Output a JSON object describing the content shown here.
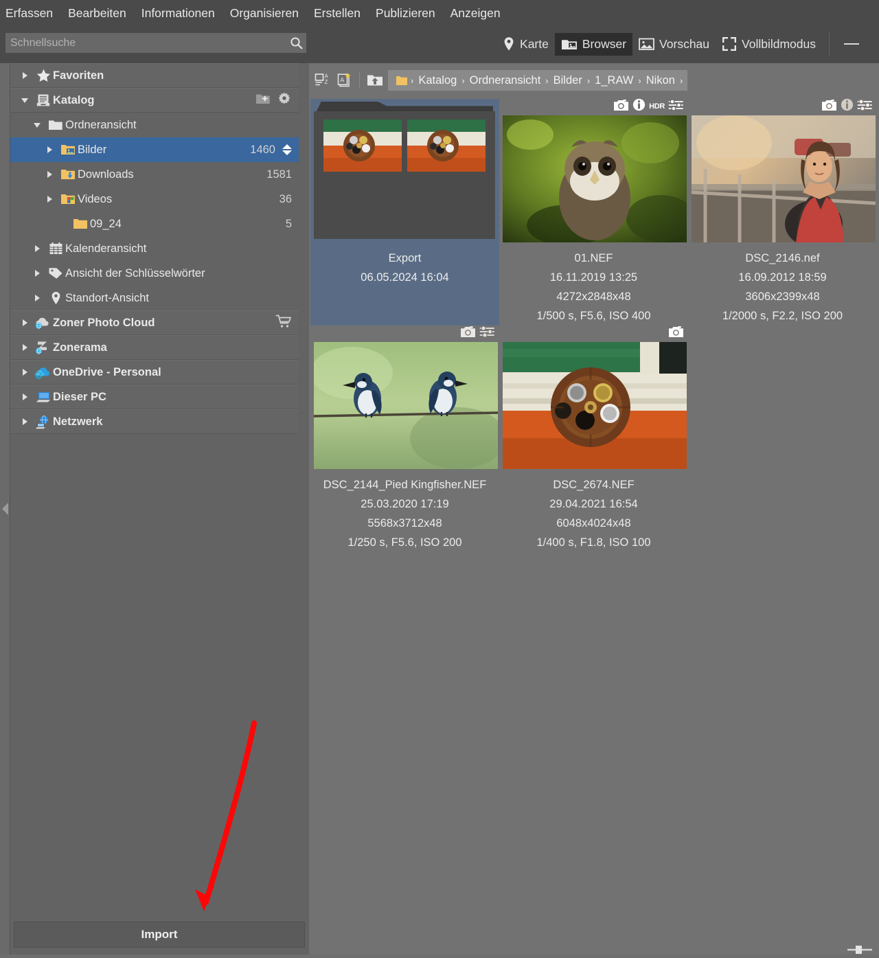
{
  "menu": {
    "items": [
      {
        "label": "Erfassen",
        "name": "menu-erfassen"
      },
      {
        "label": "Bearbeiten",
        "name": "menu-bearbeiten"
      },
      {
        "label": "Informationen",
        "name": "menu-informationen"
      },
      {
        "label": "Organisieren",
        "name": "menu-organisieren"
      },
      {
        "label": "Erstellen",
        "name": "menu-erstellen"
      },
      {
        "label": "Publizieren",
        "name": "menu-publizieren"
      },
      {
        "label": "Anzeigen",
        "name": "menu-anzeigen"
      }
    ]
  },
  "search": {
    "value": "",
    "placeholder": "Schnellsuche",
    "icon": "search-icon"
  },
  "viewmodes": {
    "items": [
      {
        "label": "Karte",
        "icon": "map-pin-icon",
        "active": false
      },
      {
        "label": "Browser",
        "icon": "browser-folder-icon",
        "active": true
      },
      {
        "label": "Vorschau",
        "icon": "preview-image-icon",
        "active": false
      },
      {
        "label": "Vollbildmodus",
        "icon": "fullscreen-icon",
        "active": false
      }
    ]
  },
  "window": {
    "minimize_label": "Minimieren"
  },
  "sidebar": {
    "nodes": [
      {
        "label": "Favoriten",
        "count": "",
        "icon": "star-icon",
        "level": 1,
        "twisty": "right",
        "bold": true,
        "group": true
      },
      {
        "label": "Katalog",
        "count": "",
        "icon": "catalog-icon",
        "level": 1,
        "twisty": "down",
        "bold": true,
        "group": true,
        "actions": [
          "add-folder-icon",
          "gear-icon"
        ]
      },
      {
        "label": "Ordneransicht",
        "count": "",
        "icon": "folder-icon",
        "level": 2,
        "twisty": "down",
        "bold": false
      },
      {
        "label": "Bilder",
        "count": "1460",
        "icon": "folder-pictures-icon",
        "level": 3,
        "twisty": "right",
        "bold": false,
        "selected": true,
        "sorter": true
      },
      {
        "label": "Downloads",
        "count": "1581",
        "icon": "folder-downloads-icon",
        "level": 3,
        "twisty": "right",
        "bold": false
      },
      {
        "label": "Videos",
        "count": "36",
        "icon": "folder-videos-icon",
        "level": 3,
        "twisty": "right",
        "bold": false
      },
      {
        "label": "09_24",
        "count": "5",
        "icon": "folder-icon",
        "level": 4,
        "twisty": "none",
        "bold": false
      },
      {
        "label": "Kalenderansicht",
        "count": "",
        "icon": "calendar-icon",
        "level": 2,
        "twisty": "right",
        "bold": false
      },
      {
        "label": "Ansicht der Schlüsselwörter",
        "count": "",
        "icon": "tag-icon",
        "level": 2,
        "twisty": "right",
        "bold": false
      },
      {
        "label": "Standort-Ansicht",
        "count": "",
        "icon": "map-pin-icon",
        "level": 2,
        "twisty": "right",
        "bold": false
      },
      {
        "label": "Zoner Photo Cloud",
        "count": "",
        "icon": "cloud-globe-icon",
        "level": 1,
        "twisty": "right",
        "bold": true,
        "group": true,
        "actions": [
          "cart-icon"
        ]
      },
      {
        "label": "Zonerama",
        "count": "",
        "icon": "zonerama-icon",
        "level": 1,
        "twisty": "right",
        "bold": true,
        "group": true
      },
      {
        "label": "OneDrive - Personal",
        "count": "",
        "icon": "onedrive-icon",
        "level": 1,
        "twisty": "right",
        "bold": true,
        "group": true
      },
      {
        "label": "Dieser PC",
        "count": "",
        "icon": "computer-icon",
        "level": 1,
        "twisty": "right",
        "bold": true,
        "group": true
      },
      {
        "label": "Netzwerk",
        "count": "",
        "icon": "network-icon",
        "level": 1,
        "twisty": "right",
        "bold": true,
        "group": true
      }
    ],
    "import_label": "Import",
    "collapse_handle": "collapse-sidebar-handle"
  },
  "breadcrumb": {
    "toolbuttons": [
      "sort-az-icon",
      "filter-copies-icon",
      "up-folder-icon"
    ],
    "root_icon": "folder-icon",
    "crumbs": [
      "Katalog",
      "Ordneransicht",
      "Bilder",
      "1_RAW",
      "Nikon"
    ],
    "separator": "›"
  },
  "browser": {
    "items": [
      {
        "kind": "folder",
        "name": "Export",
        "date": "06.05.2024 16:04",
        "dimensions": "",
        "exposure": "",
        "selected": true,
        "overlays": []
      },
      {
        "kind": "photo",
        "name": "01.NEF",
        "date": "16.11.2019 13:25",
        "dimensions": "4272x2848x48",
        "exposure": "1/500 s, F5.6, ISO 400",
        "selected": false,
        "overlays": [
          "camera-icon",
          "info-icon",
          "HDR",
          "develop-sliders-icon"
        ],
        "art": "owl"
      },
      {
        "kind": "photo",
        "name": "DSC_2146.nef",
        "date": "16.09.2012 18:59",
        "dimensions": "3606x2399x48",
        "exposure": "1/2000 s, F2.2, ISO 200",
        "selected": false,
        "overlays": [
          "camera-icon",
          "info-icon",
          "develop-sliders-icon"
        ],
        "art": "portrait"
      },
      {
        "kind": "photo",
        "name": "DSC_2144_Pied Kingfisher.NEF",
        "date": "25.03.2020 17:19",
        "dimensions": "5568x3712x48",
        "exposure": "1/250 s, F5.6, ISO 200",
        "selected": false,
        "overlays": [
          "camera-icon",
          "develop-sliders-icon"
        ],
        "art": "kingfishers"
      },
      {
        "kind": "photo",
        "name": "DSC_2674.NEF",
        "date": "29.04.2021 16:54",
        "dimensions": "6048x4024x48",
        "exposure": "1/400 s, F1.8, ISO 100",
        "selected": false,
        "overlays": [
          "camera-icon"
        ],
        "art": "wheel"
      }
    ]
  },
  "annotation": {
    "arrow_color": "#fb0707",
    "name": "red-arrow-annotation"
  },
  "colors": {
    "topbar": "#4a4a4a",
    "sidebar": "#636363",
    "main": "#727272",
    "selection_tree": "#39679e",
    "selection_thumb": "#5a6c85",
    "breadcrumb_bg": "#8a8a8a",
    "accent_folder": "#f0c060"
  }
}
